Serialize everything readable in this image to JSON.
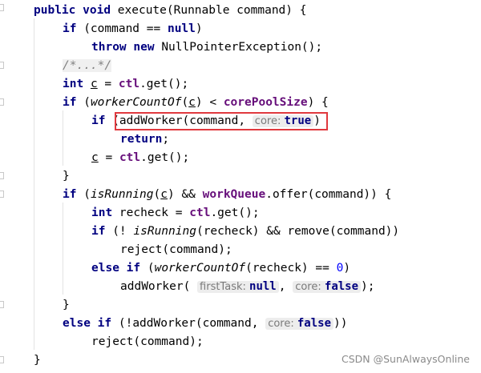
{
  "editor": {
    "lines": [
      {
        "indent": 0,
        "tokens": [
          {
            "t": "public",
            "c": "kw"
          },
          {
            "t": " "
          },
          {
            "t": "void",
            "c": "kw"
          },
          {
            "t": " execute(Runnable command) {"
          }
        ]
      },
      {
        "indent": 1,
        "tokens": [
          {
            "t": "if",
            "c": "kw"
          },
          {
            "t": " (command == "
          },
          {
            "t": "null",
            "c": "kw"
          },
          {
            "t": ")"
          }
        ]
      },
      {
        "indent": 2,
        "tokens": [
          {
            "t": "throw",
            "c": "kw"
          },
          {
            "t": " "
          },
          {
            "t": "new",
            "c": "kw"
          },
          {
            "t": " NullPointerException();"
          }
        ]
      },
      {
        "indent": 1,
        "tokens": [
          {
            "t": "/*...*/",
            "c": "cm"
          }
        ]
      },
      {
        "indent": 1,
        "tokens": [
          {
            "t": "int",
            "c": "kw"
          },
          {
            "t": " "
          },
          {
            "t": "c",
            "c": "u"
          },
          {
            "t": " = "
          },
          {
            "t": "ctl",
            "c": "field"
          },
          {
            "t": ".get();"
          }
        ]
      },
      {
        "indent": 1,
        "tokens": [
          {
            "t": "if",
            "c": "kw"
          },
          {
            "t": " ("
          },
          {
            "t": "workerCountOf",
            "c": "it"
          },
          {
            "t": "("
          },
          {
            "t": "c",
            "c": "u"
          },
          {
            "t": ") < "
          },
          {
            "t": "corePoolSize",
            "c": "field"
          },
          {
            "t": ") {"
          }
        ]
      },
      {
        "indent": 2,
        "tokens": [
          {
            "t": "if",
            "c": "kw"
          },
          {
            "t": " (addWorker(command, "
          },
          {
            "hint": "core:",
            "val": "true"
          },
          {
            "t": ")"
          }
        ]
      },
      {
        "indent": 3,
        "tokens": [
          {
            "t": "return",
            "c": "kw"
          },
          {
            "t": ";"
          }
        ]
      },
      {
        "indent": 2,
        "tokens": [
          {
            "t": "c",
            "c": "u"
          },
          {
            "t": " = "
          },
          {
            "t": "ctl",
            "c": "field"
          },
          {
            "t": ".get();"
          }
        ]
      },
      {
        "indent": 1,
        "tokens": [
          {
            "t": "}"
          }
        ]
      },
      {
        "indent": 1,
        "tokens": [
          {
            "t": "if",
            "c": "kw"
          },
          {
            "t": " ("
          },
          {
            "t": "isRunning",
            "c": "it"
          },
          {
            "t": "("
          },
          {
            "t": "c",
            "c": "u"
          },
          {
            "t": ") && "
          },
          {
            "t": "workQueue",
            "c": "field"
          },
          {
            "t": ".offer(command)) {"
          }
        ]
      },
      {
        "indent": 2,
        "tokens": [
          {
            "t": "int",
            "c": "kw"
          },
          {
            "t": " recheck = "
          },
          {
            "t": "ctl",
            "c": "field"
          },
          {
            "t": ".get();"
          }
        ]
      },
      {
        "indent": 2,
        "tokens": [
          {
            "t": "if",
            "c": "kw"
          },
          {
            "t": " (! "
          },
          {
            "t": "isRunning",
            "c": "it"
          },
          {
            "t": "(recheck) && remove(command))"
          }
        ]
      },
      {
        "indent": 3,
        "tokens": [
          {
            "t": "reject(command);"
          }
        ]
      },
      {
        "indent": 2,
        "tokens": [
          {
            "t": "else",
            "c": "kw"
          },
          {
            "t": " "
          },
          {
            "t": "if",
            "c": "kw"
          },
          {
            "t": " ("
          },
          {
            "t": "workerCountOf",
            "c": "it"
          },
          {
            "t": "(recheck) == "
          },
          {
            "t": "0",
            "c": "num"
          },
          {
            "t": ")"
          }
        ]
      },
      {
        "indent": 3,
        "tokens": [
          {
            "t": "addWorker( "
          },
          {
            "hint": "firstTask:",
            "val": "null"
          },
          {
            "t": ", "
          },
          {
            "hint": "core:",
            "val": "false"
          },
          {
            "t": ");"
          }
        ]
      },
      {
        "indent": 1,
        "tokens": [
          {
            "t": "}"
          }
        ]
      },
      {
        "indent": 1,
        "tokens": [
          {
            "t": "else",
            "c": "kw"
          },
          {
            "t": " "
          },
          {
            "t": "if",
            "c": "kw"
          },
          {
            "t": " (!addWorker(command, "
          },
          {
            "hint": "core:",
            "val": "false"
          },
          {
            "t": "))"
          }
        ]
      },
      {
        "indent": 2,
        "tokens": [
          {
            "t": "reject(command);"
          }
        ]
      },
      {
        "indent": 0,
        "tokens": [
          {
            "t": "}"
          }
        ]
      }
    ]
  },
  "watermark": "CSDN @SunAlwaysOnline",
  "colors": {
    "keyword": "#000080",
    "field": "#660e7a",
    "comment": "#808080",
    "number": "#0000ff",
    "highlight_border": "#e0393e"
  }
}
